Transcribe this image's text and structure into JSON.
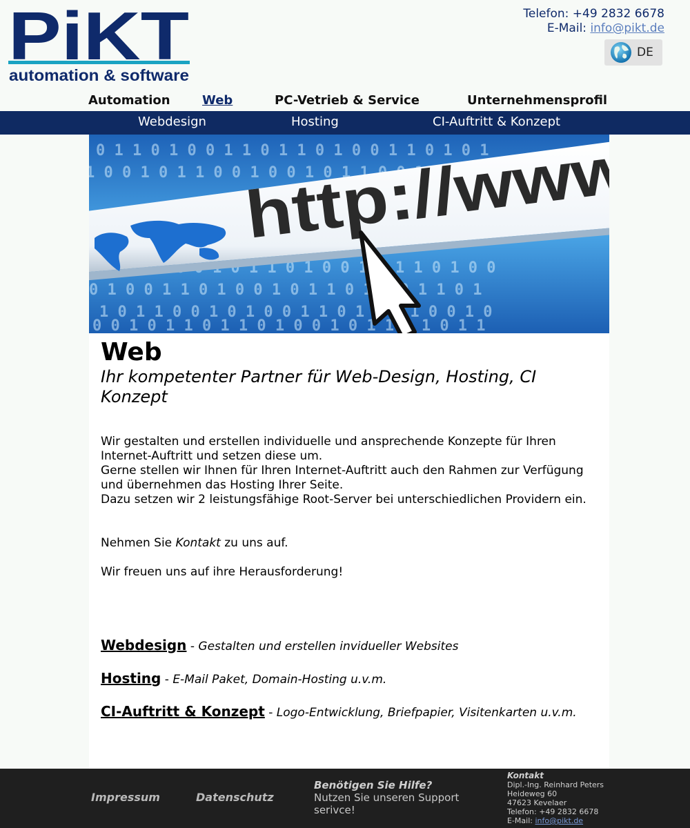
{
  "brand": {
    "logo_text": "PiKT",
    "tagline": "automation & software",
    "colors": {
      "navy": "#0f2a6b",
      "teal": "#1aa3c2",
      "subnav": "#0f2a62"
    }
  },
  "contact": {
    "phone": "Telefon: +49 2832 6678",
    "email_label": "E-Mail: ",
    "email": "info@pikt.de"
  },
  "language": {
    "icon": "globe-icon",
    "label": "DE"
  },
  "main_nav": [
    {
      "label": "Automation",
      "active": false
    },
    {
      "label": "Web",
      "active": true
    },
    {
      "label": "PC-Vetrieb & Service",
      "active": false
    },
    {
      "label": "Unternehmensprofil",
      "active": false
    }
  ],
  "sub_nav": [
    {
      "label": "Webdesign"
    },
    {
      "label": "Hosting"
    },
    {
      "label": "CI-Auftritt & Konzept"
    }
  ],
  "hero": {
    "url_text": "http://www"
  },
  "content": {
    "title": "Web",
    "subtitle": "Ihr kompetenter Partner für Web-Design, Hosting, CI Konzept",
    "paragraph_lines": [
      "Wir gestalten und erstellen individuelle und ansprechende Konzepte für Ihren Internet-Auftritt und setzen diese um.",
      "Gerne stellen wir Ihnen für Ihren Internet-Auftritt auch den Rahmen zur Verfügung und übernehmen das Hosting Ihrer Seite.",
      "Dazu setzen wir 2 leistungsfähige Root-Server bei unterschiedlichen Providern ein."
    ],
    "contact_prefix": "Nehmen Sie ",
    "contact_link": "Kontakt",
    "contact_suffix": " zu uns auf.",
    "closing": "Wir freuen uns auf ihre Herausforderung!",
    "service_links": [
      {
        "title": "Webdesign",
        "sep": " - ",
        "desc": "Gestalten und erstellen invidueller Websites"
      },
      {
        "title": "Hosting",
        "sep": " - ",
        "desc": "E-Mail Paket, Domain-Hosting u.v.m."
      },
      {
        "title": "CI-Auftritt & Konzept",
        "sep": " - ",
        "desc": "Logo-Entwicklung, Briefpapier, Visitenkarten u.v.m."
      }
    ]
  },
  "footer": {
    "impressum": "Impressum",
    "datenschutz": "Datenschutz",
    "help_title": "Benötigen Sie Hilfe?",
    "help_text": "Nutzen Sie unseren Support serivce!",
    "kontakt_title": "Kontakt",
    "kontakt_lines": [
      "Dipl.-Ing. Reinhard Peters",
      "Heideweg 60",
      "47623 Kevelaer",
      "Telefon: +49 2832 6678"
    ],
    "kontakt_email_label": "E-Mail: ",
    "kontakt_email": "info@pikt.de"
  }
}
